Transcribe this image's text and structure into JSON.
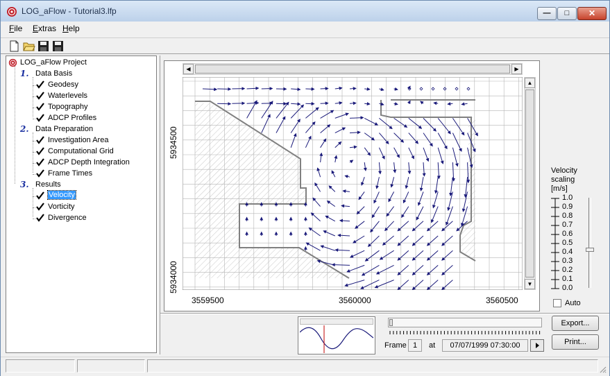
{
  "window": {
    "title": "LOG_aFlow - Tutorial3.lfp",
    "min_glyph": "—",
    "max_glyph": "□",
    "close_glyph": "✕"
  },
  "menu": {
    "file": {
      "accel": "F",
      "rest": "ile"
    },
    "extras": {
      "accel": "E",
      "rest": "xtras"
    },
    "help": {
      "accel": "H",
      "rest": "elp"
    }
  },
  "toolbar": {
    "buttons": [
      "new-file-icon",
      "open-folder-icon",
      "save-icon",
      "save-as-icon"
    ]
  },
  "tree": {
    "root": "LOG_aFlow Project",
    "groups": [
      {
        "num": "1.",
        "label": "Data Basis",
        "items": [
          "Geodesy",
          "Waterlevels",
          "Topography",
          "ADCP Profiles"
        ]
      },
      {
        "num": "2.",
        "label": "Data Preparation",
        "items": [
          "Investigation Area",
          "Computational Grid",
          "ADCP Depth Integration",
          "Frame Times"
        ]
      },
      {
        "num": "3.",
        "label": "Results",
        "items": [
          "Velocity",
          "Vorticity",
          "Divergence"
        ]
      }
    ],
    "selected": "Velocity"
  },
  "map": {
    "y_ticks": [
      "5934500",
      "5934000"
    ],
    "x_ticks": [
      "3559500",
      "3560000",
      "3560500"
    ],
    "arrow_color": "#1a1a7a",
    "grid_color": "#b4b4b4",
    "boundary_color": "#808080"
  },
  "scale": {
    "title_lines": [
      "Velocity",
      "scaling",
      "[m/s]"
    ],
    "ticks": [
      "1.0",
      "0.9",
      "0.8",
      "0.7",
      "0.6",
      "0.5",
      "0.4",
      "0.3",
      "0.2",
      "0.1",
      "0.0"
    ],
    "auto_label": "Auto",
    "auto_checked": false
  },
  "playback": {
    "frame_label": "Frame",
    "frame_value": "1",
    "at_label": "at",
    "datetime": "07/07/1999 07:30:00"
  },
  "buttons": {
    "export": "Export...",
    "print": "Print..."
  }
}
